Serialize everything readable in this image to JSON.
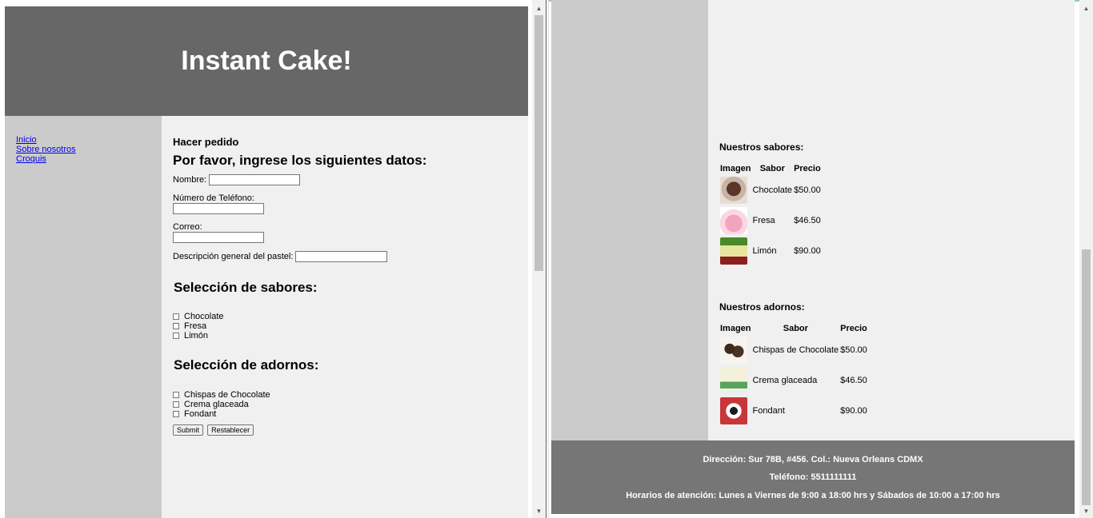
{
  "left": {
    "title": "Instant Cake!",
    "nav": [
      "Inicio",
      "Sobre nosotros",
      "Croquis"
    ],
    "form": {
      "heading": "Hacer pedido",
      "subheading": "Por favor, ingrese los siguientes datos:",
      "fields": {
        "nombre": "Nombre:",
        "telefono": "Número de Teléfono:",
        "correo": "Correo:",
        "descripcion": "Descripción general del pastel:"
      },
      "flavors_heading": "Selección de sabores:",
      "flavors": [
        "Chocolate",
        "Fresa",
        "Limón"
      ],
      "toppings_heading": "Selección de adornos:",
      "toppings": [
        "Chispas de Chocolate",
        "Crema glaceada",
        "Fondant"
      ],
      "submit_label": "Submit",
      "reset_label": "Restablecer"
    }
  },
  "right": {
    "flavors_title": "Nuestros sabores:",
    "flavors_table": {
      "headers": [
        "Imagen",
        "Sabor",
        "Precio"
      ],
      "rows": [
        {
          "name": "Chocolate",
          "price": "$50.00"
        },
        {
          "name": "Fresa",
          "price": "$46.50"
        },
        {
          "name": "Limón",
          "price": "$90.00"
        }
      ]
    },
    "toppings_title": "Nuestros adornos:",
    "toppings_table": {
      "headers": [
        "Imagen",
        "Sabor",
        "Precio"
      ],
      "rows": [
        {
          "name": "Chispas de Chocolate",
          "price": "$50.00"
        },
        {
          "name": "Crema glaceada",
          "price": "$46.50"
        },
        {
          "name": "Fondant",
          "price": "$90.00"
        }
      ]
    },
    "footer": {
      "address": "Dirección: Sur 78B, #456. Col.: Nueva Orleans CDMX",
      "phone": "Teléfono: 5511111111",
      "hours": "Horarios de atención: Lunes a Viernes de 9:00 a 18:00 hrs y Sábados de 10:00 a 17:00 hrs"
    }
  },
  "colors": {
    "header_bg": "#676767",
    "nav_bg": "#cbcbcb",
    "main_bg": "#f0f0f0",
    "footer_bg": "#767676",
    "link": "#0000ee"
  }
}
